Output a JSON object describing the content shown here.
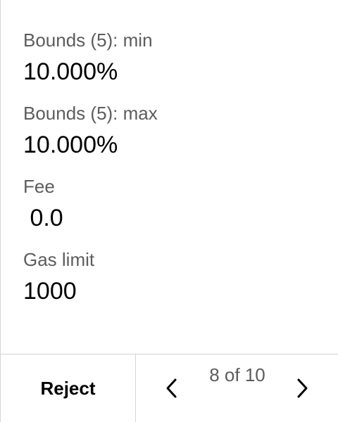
{
  "fields": [
    {
      "label": "Bounds (5): min",
      "value": "10.000%"
    },
    {
      "label": "Bounds (5): max",
      "value": "10.000%"
    },
    {
      "label": "Fee",
      "value": " 0.0"
    },
    {
      "label": "Gas limit",
      "value": "1000"
    }
  ],
  "footer": {
    "reject_label": "Reject",
    "page_indicator": "8 of 10",
    "prev_icon": "chevron-left-icon",
    "next_icon": "chevron-right-icon"
  }
}
